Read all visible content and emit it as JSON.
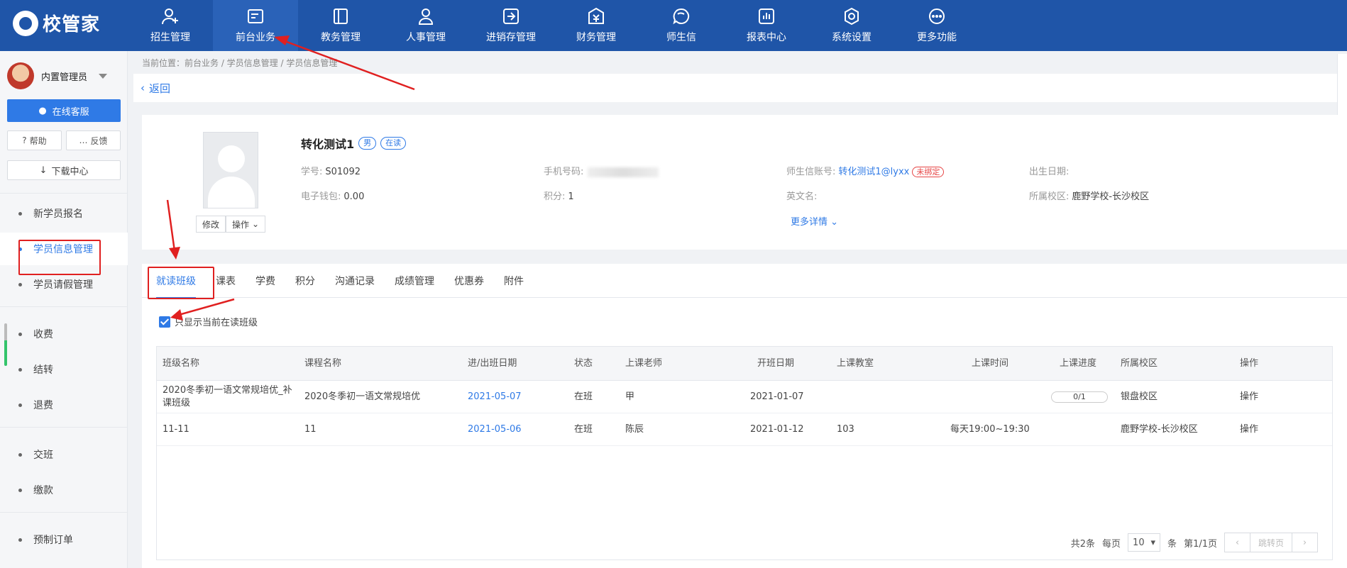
{
  "app": {
    "logo_text": "校管家"
  },
  "nav": [
    {
      "label": "招生管理",
      "icon": "user-plus-icon"
    },
    {
      "label": "前台业务",
      "icon": "front-desk-icon"
    },
    {
      "label": "教务管理",
      "icon": "book-icon"
    },
    {
      "label": "人事管理",
      "icon": "person-icon"
    },
    {
      "label": "进销存管理",
      "icon": "inventory-icon"
    },
    {
      "label": "财务管理",
      "icon": "finance-icon"
    },
    {
      "label": "师生信",
      "icon": "chat-icon"
    },
    {
      "label": "报表中心",
      "icon": "report-icon"
    },
    {
      "label": "系统设置",
      "icon": "settings-icon"
    },
    {
      "label": "更多功能",
      "icon": "more-icon"
    }
  ],
  "sidebar": {
    "user_name": "内置管理员",
    "online_service": "在线客服",
    "help": "帮助",
    "feedback": "反馈",
    "download_center": "下载中心",
    "items": [
      {
        "label": "新学员报名"
      },
      {
        "label": "学员信息管理"
      },
      {
        "label": "学员请假管理"
      },
      {
        "label": "收费"
      },
      {
        "label": "结转"
      },
      {
        "label": "退费"
      },
      {
        "label": "交班"
      },
      {
        "label": "缴款"
      },
      {
        "label": "预制订单"
      }
    ]
  },
  "breadcrumb": "当前位置：前台业务 / 学员信息管理 / 学员信息管理",
  "back_label": "返回",
  "student": {
    "name": "转化测试1",
    "gender_tag": "男",
    "status_tag": "在读",
    "edit_btn": "修改",
    "action_btn": "操作",
    "student_no_label": "学号:",
    "student_no": "S01092",
    "phone_label": "手机号码:",
    "account_label": "师生信账号:",
    "account": "转化测试1@lyxx",
    "account_tag": "未绑定",
    "birth_label": "出生日期:",
    "wallet_label": "电子钱包:",
    "wallet": "0.00",
    "points_label": "积分:",
    "points": "1",
    "en_name_label": "英文名:",
    "campus_label": "所属校区:",
    "campus": "鹿野学校-长沙校区",
    "more_details": "更多详情"
  },
  "tabs": [
    {
      "label": "就读班级"
    },
    {
      "label": "课表"
    },
    {
      "label": "学费"
    },
    {
      "label": "积分"
    },
    {
      "label": "沟通记录"
    },
    {
      "label": "成绩管理"
    },
    {
      "label": "优惠券"
    },
    {
      "label": "附件"
    }
  ],
  "filter_label": "只显示当前在读班级",
  "table": {
    "headers": [
      "班级名称",
      "课程名称",
      "进/出班日期",
      "状态",
      "上课老师",
      "开班日期",
      "上课教室",
      "上课时间",
      "上课进度",
      "所属校区",
      "操作"
    ],
    "rows": [
      {
        "class_name": "2020冬季初一语文常规培优_补课班级",
        "course": "2020冬季初一语文常规培优",
        "date": "2021-05-07",
        "status": "在班",
        "teacher": "甲",
        "start": "2021-01-07",
        "room": "",
        "time": "",
        "progress": "0/1",
        "campus": "银盘校区",
        "op": "操作"
      },
      {
        "class_name": "11-11",
        "course": "11",
        "date": "2021-05-06",
        "status": "在班",
        "teacher": "陈辰",
        "start": "2021-01-12",
        "room": "103",
        "time": "每天19:00~19:30",
        "progress": "",
        "campus": "鹿野学校-长沙校区",
        "op": "操作"
      }
    ]
  },
  "pager": {
    "total": "共2条",
    "per_page": "每页",
    "size": "10",
    "unit": "条",
    "page_info": "第1/1页",
    "jump": "跳转页"
  },
  "colors": {
    "topbar": "#1f55a8",
    "accent": "#2f7ae6",
    "annotation": "#e02020"
  }
}
